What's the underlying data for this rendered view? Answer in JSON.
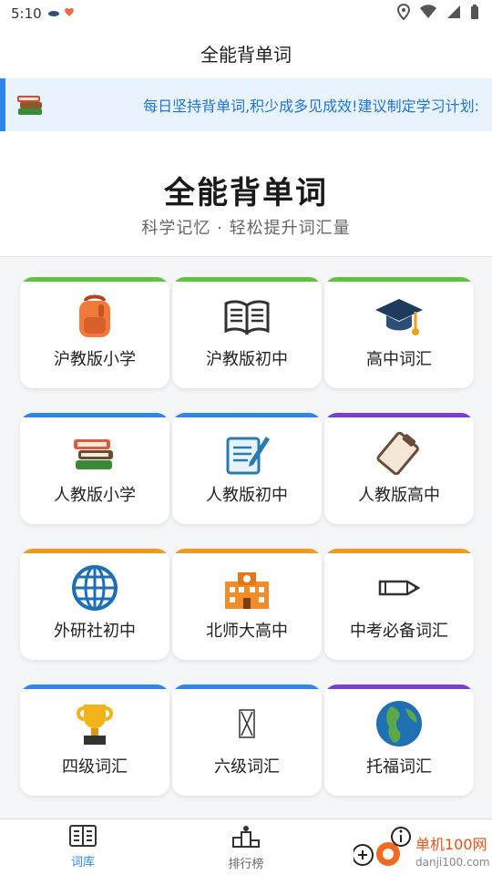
{
  "status_bar": {
    "time": "5:10"
  },
  "app_bar": {
    "title": "全能背单词"
  },
  "notice": {
    "text": "每日坚持背单词,积少成多见成效!建议制定学习计划:"
  },
  "hero": {
    "title": "全能背单词",
    "subtitle": "科学记忆 · 轻松提升词汇量"
  },
  "categories": [
    {
      "label": "沪教版小学",
      "accent": "#5cc63a",
      "icon": "backpack-icon"
    },
    {
      "label": "沪教版初中",
      "accent": "#5cc63a",
      "icon": "open-book-icon"
    },
    {
      "label": "高中词汇",
      "accent": "#5cc63a",
      "icon": "graduation-cap-icon"
    },
    {
      "label": "人教版小学",
      "accent": "#2f86e6",
      "icon": "book-stack-icon"
    },
    {
      "label": "人教版初中",
      "accent": "#2f86e6",
      "icon": "notebook-pen-icon"
    },
    {
      "label": "人教版高中",
      "accent": "#7b3fd0",
      "icon": "clipboard-icon"
    },
    {
      "label": "外研社初中",
      "accent": "#f39a1c",
      "icon": "globe-icon"
    },
    {
      "label": "北师大高中",
      "accent": "#f39a1c",
      "icon": "school-building-icon"
    },
    {
      "label": "中考必备词汇",
      "accent": "#f39a1c",
      "icon": "pencil-icon"
    },
    {
      "label": "四级词汇",
      "accent": "#2f86e6",
      "icon": "trophy-icon"
    },
    {
      "label": "六级词汇",
      "accent": "#2f86e6",
      "icon": "hourglass-icon"
    },
    {
      "label": "托福词汇",
      "accent": "#7b3fd0",
      "icon": "earth-icon"
    }
  ],
  "tabs": [
    {
      "label": "词库",
      "icon": "word-library-icon",
      "active": true
    },
    {
      "label": "排行榜",
      "icon": "podium-icon",
      "active": false
    }
  ],
  "watermark": {
    "text1": "单机100网",
    "text2": "danji100.com"
  },
  "colors": {
    "active_tab": "#2f86e6",
    "inactive_tab": "#666666",
    "notice_text": "#1f74d6",
    "notice_bg": "#e9f3fd"
  }
}
